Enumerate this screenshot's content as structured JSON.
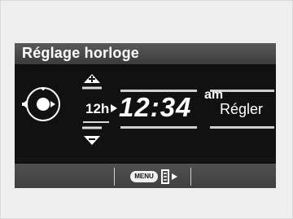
{
  "screen": {
    "title": "Réglage horloge",
    "hour_format": "12h",
    "time": "12:34",
    "ampm": "am",
    "action_label": "Régler",
    "menu_label": "MENU"
  },
  "icons": {
    "knob": "rotary-knob-icon",
    "up": "arrow-up-plus-icon",
    "down": "arrow-down-minus-icon",
    "book": "book-next-icon"
  },
  "colors": {
    "display_bg": "#111111",
    "bar_top": "#5a5a5a",
    "bar_bottom": "#3b3b3b",
    "text": "#ffffff"
  }
}
